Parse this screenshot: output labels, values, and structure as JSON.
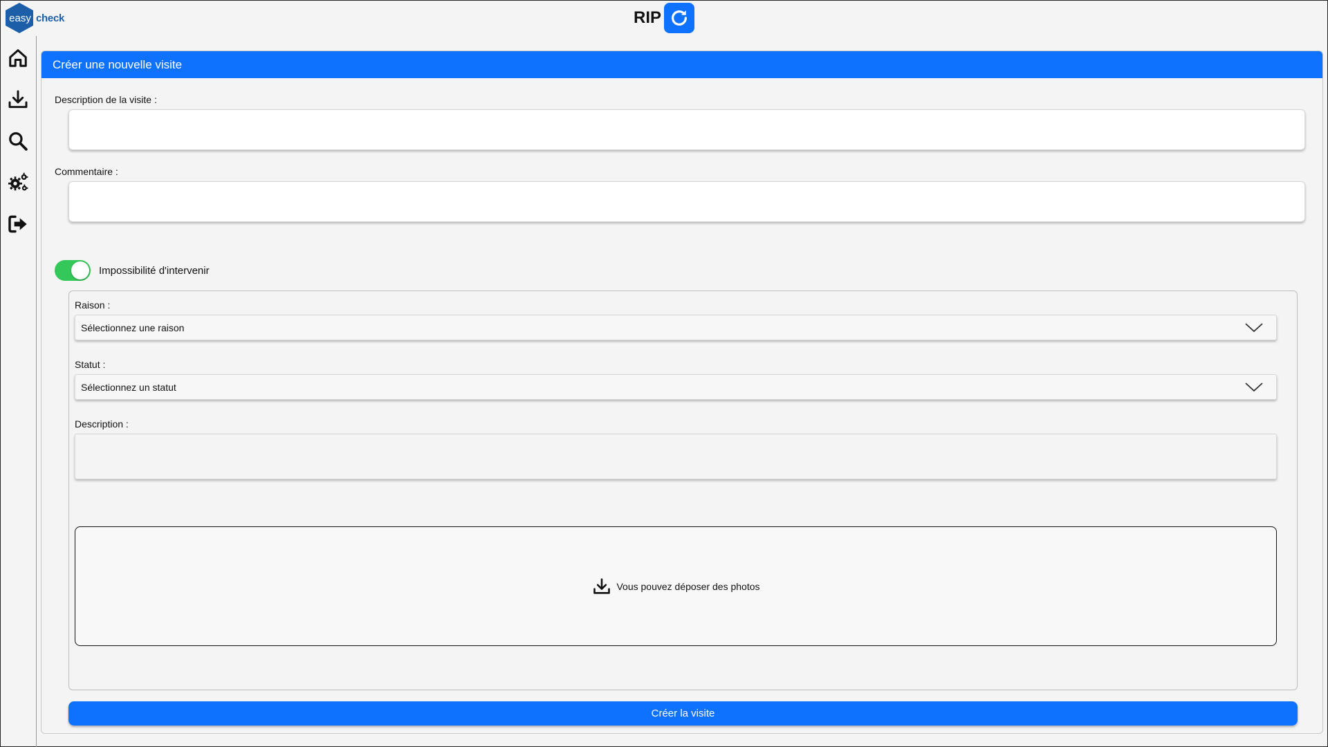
{
  "header": {
    "logo_text_left": "easy",
    "logo_text_right": "check",
    "app_title": "RIP",
    "refresh_icon": "refresh-icon"
  },
  "sidebar": {
    "items": [
      {
        "icon": "home-icon"
      },
      {
        "icon": "download-icon"
      },
      {
        "icon": "search-icon"
      },
      {
        "icon": "gears-icon"
      },
      {
        "icon": "logout-icon"
      }
    ]
  },
  "form": {
    "title": "Créer une nouvelle visite",
    "description_label": "Description de la visite :",
    "description_value": "",
    "comment_label": "Commentaire :",
    "comment_value": "",
    "toggle_label": "Impossibilité d'intervenir",
    "toggle_on": true,
    "reason_label": "Raison :",
    "reason_value": "Sélectionnez une raison",
    "status_label": "Statut :",
    "status_value": "Sélectionnez un statut",
    "desc2_label": "Description :",
    "dropzone_text": "Vous pouvez déposer des photos",
    "submit_label": "Créer la visite"
  },
  "colors": {
    "primary": "#0f72ff",
    "toggle_on": "#34c759",
    "logo": "#1c5fa8"
  }
}
